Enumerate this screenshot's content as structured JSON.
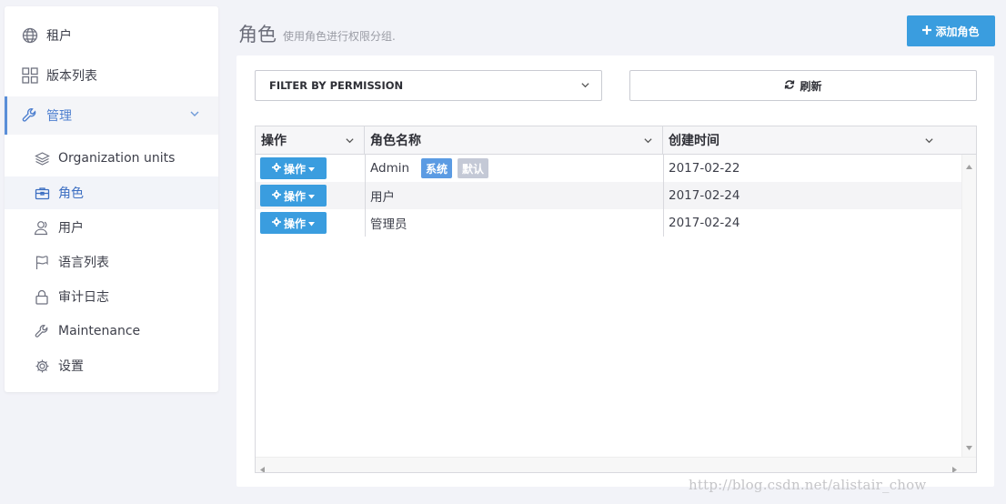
{
  "sidebar": {
    "items": [
      {
        "label": "租户",
        "icon": "globe-icon"
      },
      {
        "label": "版本列表",
        "icon": "grid-icon"
      },
      {
        "label": "管理",
        "icon": "wrench-icon",
        "expanded": true
      }
    ],
    "subitems": [
      {
        "label": "Organization units",
        "icon": "layers-icon"
      },
      {
        "label": "角色",
        "icon": "briefcase-icon",
        "active": true
      },
      {
        "label": "用户",
        "icon": "users-icon"
      },
      {
        "label": "语言列表",
        "icon": "flag-icon"
      },
      {
        "label": "审计日志",
        "icon": "lock-icon"
      },
      {
        "label": "Maintenance",
        "icon": "wrench-icon"
      },
      {
        "label": "设置",
        "icon": "gear-icon"
      }
    ]
  },
  "header": {
    "title": "角色",
    "subtitle": "使用角色进行权限分组.",
    "add_label": "添加角色"
  },
  "toolbar": {
    "filter_label": "FILTER BY PERMISSION",
    "refresh_label": "刷新"
  },
  "grid": {
    "columns": [
      "操作",
      "角色名称",
      "创建时间"
    ],
    "action_label": "操作",
    "rows": [
      {
        "name": "Admin",
        "badges": [
          "系统",
          "默认"
        ],
        "created": "2017-02-22"
      },
      {
        "name": "用户",
        "badges": [],
        "created": "2017-02-24"
      },
      {
        "name": "管理员",
        "badges": [],
        "created": "2017-02-24"
      }
    ]
  },
  "watermark": "http://blog.csdn.net/alistair_chow",
  "colors": {
    "accent": "#3a9ddf",
    "badge_system": "#5b9be3",
    "badge_default": "#c4c9d6"
  }
}
